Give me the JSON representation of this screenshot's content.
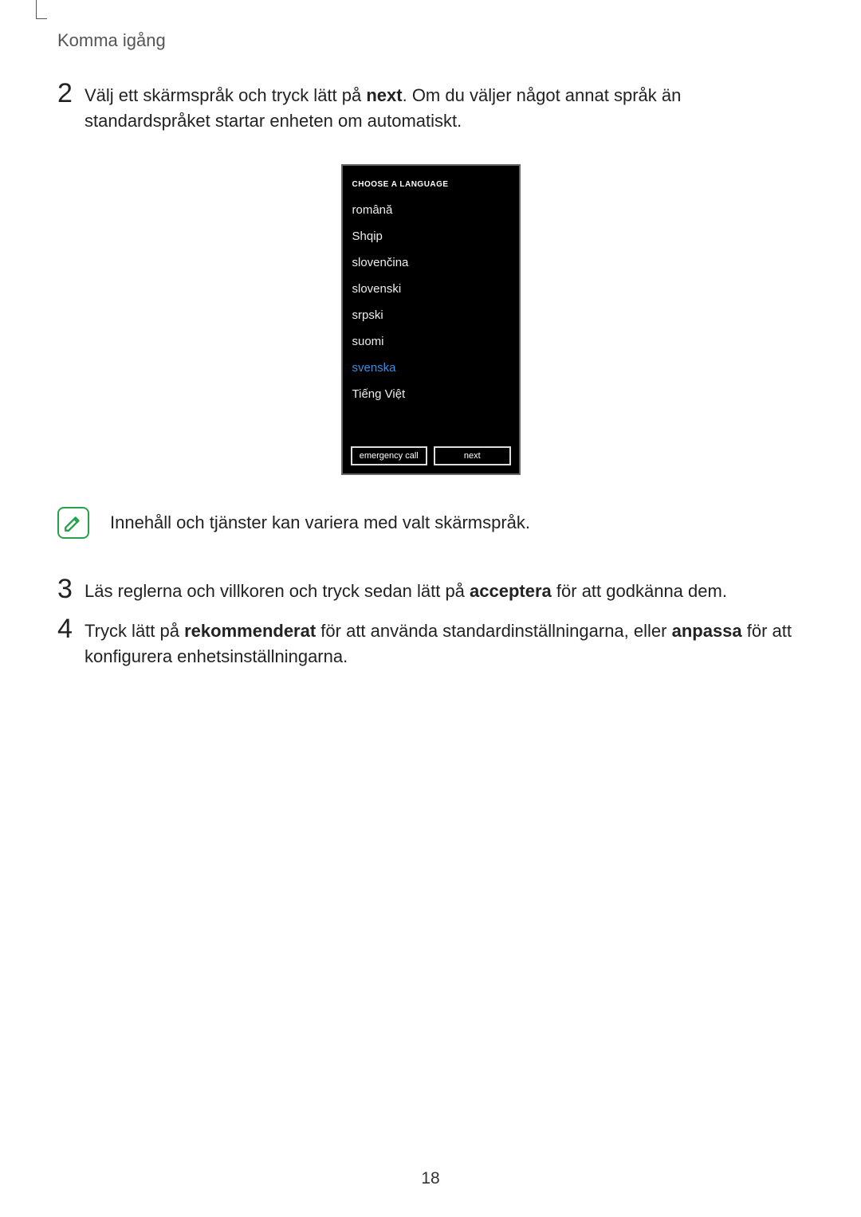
{
  "breadcrumb": "Komma igång",
  "step2": {
    "num": "2",
    "text_pre": "Välj ett skärmspråk och tryck lätt på ",
    "text_bold": "next",
    "text_post": ". Om du väljer något annat språk än standardspråket startar enheten om automatiskt."
  },
  "phone": {
    "title": "CHOOSE A LANGUAGE",
    "languages": [
      "română",
      "Shqip",
      "slovenčina",
      "slovenski",
      "srpski",
      "suomi",
      "svenska",
      "Tiếng Việt"
    ],
    "selected_index": 6,
    "btn_emergency": "emergency call",
    "btn_next": "next"
  },
  "note_text": "Innehåll och tjänster kan variera med valt skärmspråk.",
  "step3": {
    "num": "3",
    "text_pre": "Läs reglerna och villkoren och tryck sedan lätt på ",
    "text_bold": "acceptera",
    "text_post": " för att godkänna dem."
  },
  "step4": {
    "num": "4",
    "text_a": "Tryck lätt på ",
    "text_b1": "rekommenderat",
    "text_c": " för att använda standardinställningarna, eller ",
    "text_b2": "anpassa",
    "text_d": " för att konfigurera enhetsinställningarna."
  },
  "page_number": "18"
}
